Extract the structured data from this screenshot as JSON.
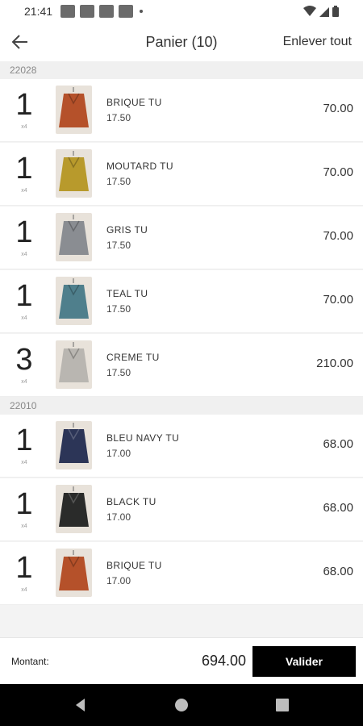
{
  "status": {
    "time": "21:41"
  },
  "header": {
    "title": "Panier (10)",
    "clear_label": "Enlever tout"
  },
  "groups": [
    {
      "code": "22028",
      "items": [
        {
          "qty": "1",
          "sub": "x4",
          "name": "BRIQUE TU",
          "unit_price": "17.50",
          "total": "70.00",
          "color": "#b5512a"
        },
        {
          "qty": "1",
          "sub": "x4",
          "name": "MOUTARD TU",
          "unit_price": "17.50",
          "total": "70.00",
          "color": "#b89a2c"
        },
        {
          "qty": "1",
          "sub": "x4",
          "name": "GRIS TU",
          "unit_price": "17.50",
          "total": "70.00",
          "color": "#8a8d92"
        },
        {
          "qty": "1",
          "sub": "x4",
          "name": "TEAL TU",
          "unit_price": "17.50",
          "total": "70.00",
          "color": "#4f7f8c"
        },
        {
          "qty": "3",
          "sub": "x4",
          "name": "CREME TU",
          "unit_price": "17.50",
          "total": "210.00",
          "color": "#b9b6b1"
        }
      ]
    },
    {
      "code": "22010",
      "items": [
        {
          "qty": "1",
          "sub": "x4",
          "name": "BLEU NAVY TU",
          "unit_price": "17.00",
          "total": "68.00",
          "color": "#2c3557"
        },
        {
          "qty": "1",
          "sub": "x4",
          "name": "BLACK TU",
          "unit_price": "17.00",
          "total": "68.00",
          "color": "#2a2b2a"
        },
        {
          "qty": "1",
          "sub": "x4",
          "name": "BRIQUE TU",
          "unit_price": "17.00",
          "total": "68.00",
          "color": "#b5512a"
        }
      ]
    }
  ],
  "footer": {
    "amount_label": "Montant:",
    "amount_value": "694.00",
    "validate_label": "Valider"
  },
  "icons": {
    "back": "arrow-left-icon",
    "wifi": "wifi-icon",
    "signal": "signal-icon",
    "battery": "battery-icon"
  }
}
